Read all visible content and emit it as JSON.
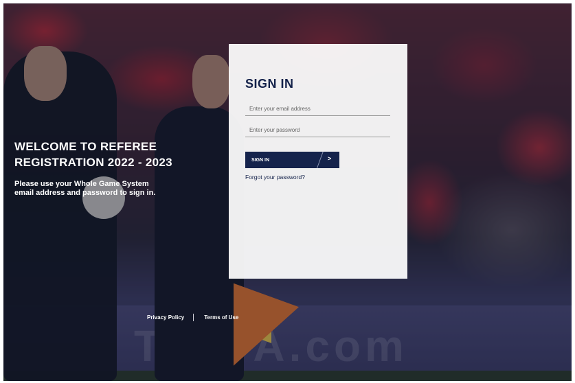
{
  "welcome": {
    "heading_line1": "WELCOME TO REFEREE",
    "heading_line2": "REGISTRATION 2022 - 2023",
    "subtext_line1": "Please use your Whole Game System",
    "subtext_line2": "email address and password to sign in."
  },
  "signin": {
    "title": "SIGN IN",
    "email_placeholder": "Enter your email address",
    "email_value": "",
    "password_placeholder": "Enter your password",
    "password_value": "",
    "button_label": "SIGN IN",
    "button_arrow": ">",
    "forgot_link": "Forgot your password?"
  },
  "footer": {
    "privacy": "Privacy Policy",
    "terms": "Terms of Use"
  },
  "background": {
    "board_text": "TheFA.com"
  },
  "colors": {
    "navy": "#15234c",
    "card_bg": "#ffffff"
  }
}
